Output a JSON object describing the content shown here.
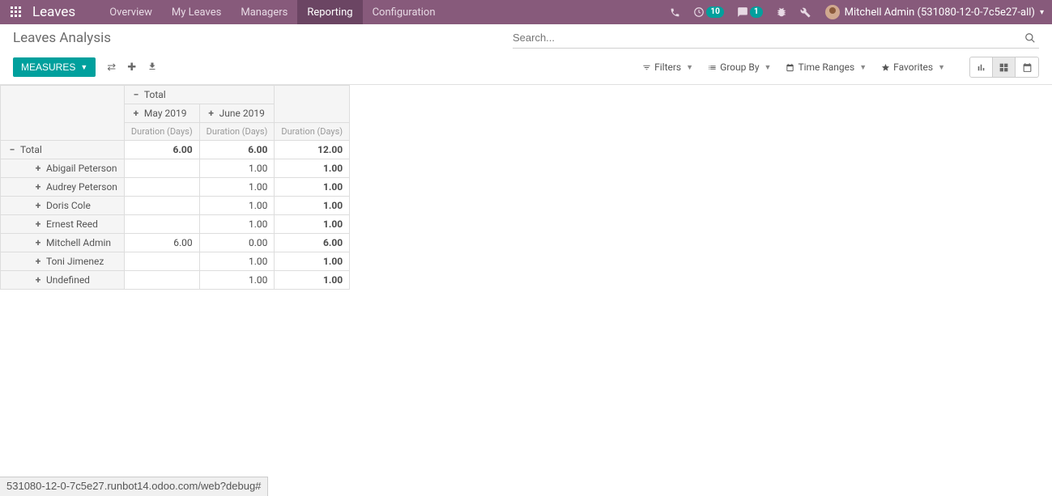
{
  "navbar": {
    "brand": "Leaves",
    "menu": [
      {
        "label": "Overview"
      },
      {
        "label": "My Leaves"
      },
      {
        "label": "Managers"
      },
      {
        "label": "Reporting"
      },
      {
        "label": "Configuration"
      }
    ],
    "activity_badge": "10",
    "discuss_badge": "1",
    "user_name": "Mitchell Admin (531080-12-0-7c5e27-all)"
  },
  "header": {
    "title": "Leaves Analysis",
    "search_placeholder": "Search...",
    "measures_label": "MEASURES",
    "filters_label": "Filters",
    "groupby_label": "Group By",
    "timeranges_label": "Time Ranges",
    "favorites_label": "Favorites"
  },
  "pivot": {
    "col_total": "Total",
    "cols": [
      "May 2019",
      "June 2019"
    ],
    "measure_label": "Duration (Days)",
    "row_total_label": "Total",
    "totals": {
      "may": "6.00",
      "june": "6.00",
      "grand": "12.00"
    },
    "rows": [
      {
        "name": "Abigail Peterson",
        "may": "",
        "june": "1.00",
        "total": "1.00"
      },
      {
        "name": "Audrey Peterson",
        "may": "",
        "june": "1.00",
        "total": "1.00"
      },
      {
        "name": "Doris Cole",
        "may": "",
        "june": "1.00",
        "total": "1.00"
      },
      {
        "name": "Ernest Reed",
        "may": "",
        "june": "1.00",
        "total": "1.00"
      },
      {
        "name": "Mitchell Admin",
        "may": "6.00",
        "june": "0.00",
        "total": "6.00"
      },
      {
        "name": "Toni Jimenez",
        "may": "",
        "june": "1.00",
        "total": "1.00"
      },
      {
        "name": "Undefined",
        "may": "",
        "june": "1.00",
        "total": "1.00"
      }
    ]
  },
  "status_bar": "531080-12-0-7c5e27.runbot14.odoo.com/web?debug#"
}
